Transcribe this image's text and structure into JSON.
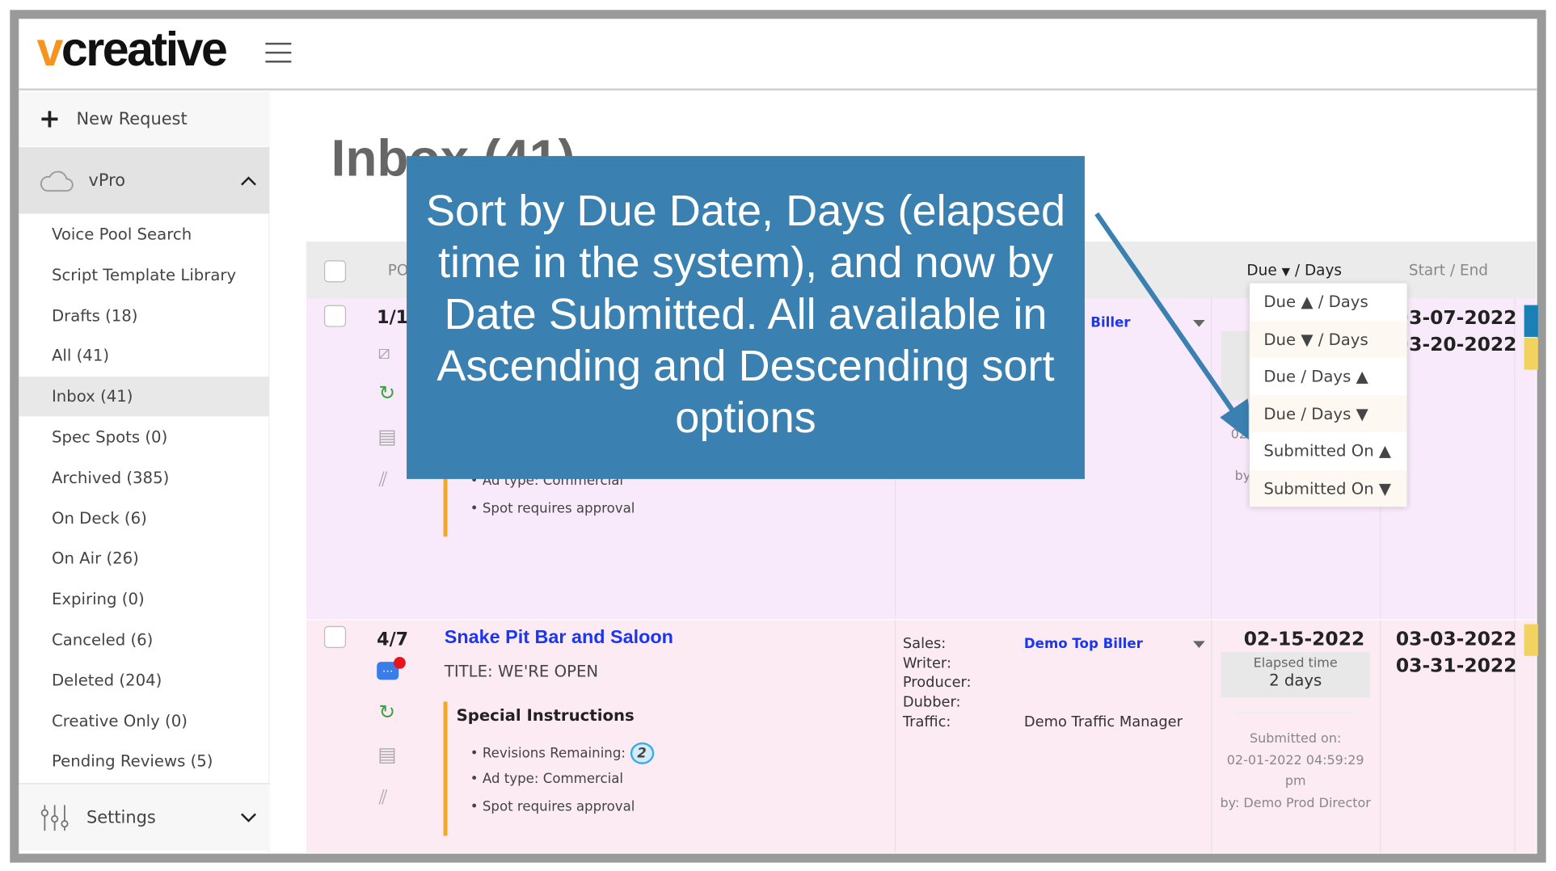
{
  "app": {
    "logo_prefix": "v",
    "logo_rest": "creative"
  },
  "sidebar": {
    "new_request": "New Request",
    "section": "vPro",
    "items": [
      {
        "label": "Voice Pool Search"
      },
      {
        "label": "Script Template Library"
      },
      {
        "label": "Drafts (18)"
      },
      {
        "label": "All (41)"
      },
      {
        "label": "Inbox (41)",
        "active": true
      },
      {
        "label": "Spec Spots (0)"
      },
      {
        "label": "Archived (385)"
      },
      {
        "label": "On Deck (6)"
      },
      {
        "label": "On Air (26)"
      },
      {
        "label": "Expiring (0)"
      },
      {
        "label": "Canceled (6)"
      },
      {
        "label": "Deleted (204)"
      },
      {
        "label": "Creative Only (0)"
      },
      {
        "label": "Pending Reviews (5)"
      }
    ],
    "settings": "Settings"
  },
  "main": {
    "title": "Inbox (41)",
    "columns": {
      "po": "PO",
      "due_days": "Due",
      "due_days_rest": "/ Days",
      "start_end": "Start / End"
    },
    "rows": [
      {
        "position": "1/1",
        "sales_name": "Biller",
        "ad_type": "Ad type: Commercial",
        "approval": "Spot requires approval",
        "submitted_prefix": "02",
        "by_prefix": "by",
        "start": "03-07-2022",
        "end": "03-20-2022"
      },
      {
        "position": "4/7",
        "client": "Snake Pit Bar and Saloon",
        "title": "TITLE: WE'RE OPEN",
        "instructions_heading": "Special Instructions",
        "revisions_label": "Revisions Remaining:",
        "revisions": "2",
        "ad_type": "Ad type: Commercial",
        "approval": "Spot requires approval",
        "roles": [
          {
            "label": "Sales:",
            "value": "Demo Top Biller"
          },
          {
            "label": "Writer:",
            "value": ""
          },
          {
            "label": "Producer:",
            "value": ""
          },
          {
            "label": "Dubber:",
            "value": ""
          },
          {
            "label": "Traffic:",
            "value": "Demo Traffic Manager"
          }
        ],
        "due": "02-15-2022",
        "elapsed_label": "Elapsed time",
        "elapsed": "2 days",
        "submitted_label": "Submitted on:",
        "submitted_date": "02-01-2022 04:59:29",
        "submitted_ampm": "pm",
        "submitted_by": "by: Demo Prod Director",
        "start": "03-03-2022",
        "end": "03-31-2022"
      }
    ]
  },
  "sort_menu": {
    "options": [
      "Due ▲ / Days",
      "Due ▼ / Days",
      "Due / Days ▲",
      "Due / Days ▼",
      "Submitted On ▲",
      "Submitted On ▼"
    ]
  },
  "callout": {
    "text": "Sort by Due Date, Days (elapsed time in the system), and now by Date Submitted. All available in Ascending and Descending sort options",
    "color": "#3a80b0"
  },
  "colors": {
    "brand_orange": "#f7941d",
    "link_blue": "#1a36f0",
    "row_lavender": "#f9eafb",
    "row_pink": "#fdebf3"
  }
}
